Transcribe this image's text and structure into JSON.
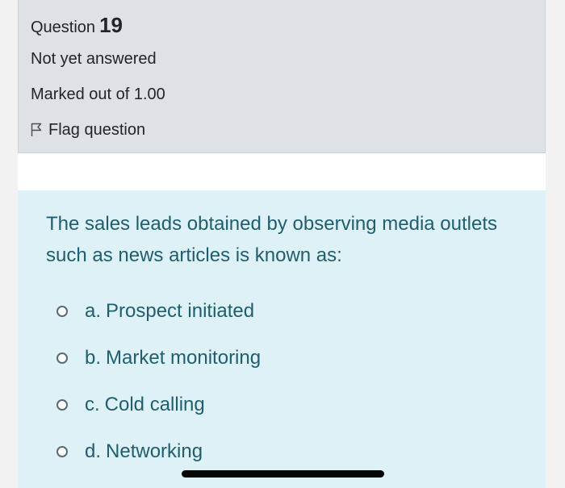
{
  "question_info": {
    "label": "Question",
    "number": "19",
    "status": "Not yet answered",
    "marks": "Marked out of 1.00",
    "flag_label": "Flag question"
  },
  "question": {
    "text": "The sales leads obtained by observing media outlets such as news articles is known as:",
    "options": [
      {
        "letter": "a.",
        "text": "Prospect initiated"
      },
      {
        "letter": "b.",
        "text": "Market monitoring"
      },
      {
        "letter": "c.",
        "text": "Cold calling"
      },
      {
        "letter": "d.",
        "text": "Networking"
      }
    ]
  },
  "colors": {
    "info_bg": "#dee2e6",
    "content_bg": "#def1f7",
    "question_text": "#1f5e6e"
  }
}
